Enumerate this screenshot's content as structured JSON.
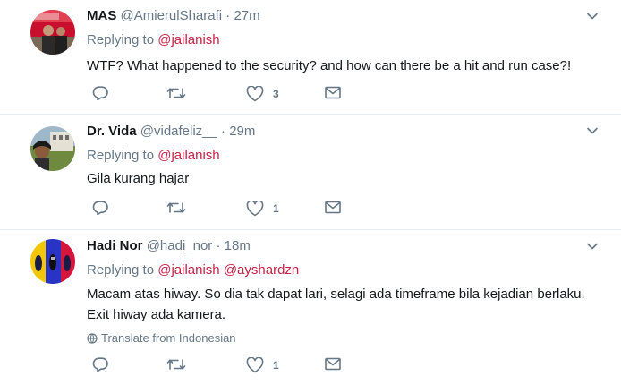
{
  "tweets": [
    {
      "name": "MAS",
      "handle": "@AmierulSharafi",
      "dot": "·",
      "time": "27m",
      "replying_prefix": "Replying to",
      "mentions": [
        "@jailanish"
      ],
      "text": "WTF? What happened to the security? and how can there be a hit and run case?!",
      "likes": "3"
    },
    {
      "name": "Dr. Vida",
      "handle": "@vidafeliz__",
      "dot": "·",
      "time": "29m",
      "replying_prefix": "Replying to",
      "mentions": [
        "@jailanish"
      ],
      "text": "Gila kurang hajar",
      "likes": "1"
    },
    {
      "name": "Hadi Nor",
      "handle": "@hadi_nor",
      "dot": "·",
      "time": "18m",
      "replying_prefix": "Replying to",
      "mentions": [
        "@jailanish",
        "@ayshardzn"
      ],
      "text": "Macam atas hiway. So dia tak dapat lari, selagi ada timeframe bila kejadian berlaku. Exit hiway ada kamera.",
      "translate_label": "Translate from Indonesian",
      "likes": "1"
    }
  ],
  "icons": {
    "reply": "reply-icon",
    "retweet": "retweet-icon",
    "like": "heart-icon",
    "dm": "envelope-icon",
    "caret": "chevron-down-icon",
    "globe": "globe-icon"
  },
  "colors": {
    "mention": "#c71f44",
    "muted": "#657786",
    "divider": "#e6ecf0"
  }
}
